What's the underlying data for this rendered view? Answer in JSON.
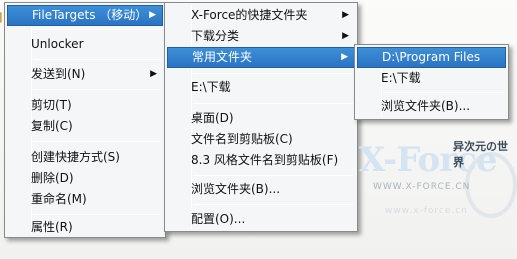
{
  "menu1": {
    "items": [
      {
        "label": "FileTargets （移动）",
        "submenu": true,
        "highlighted": true
      },
      {
        "label": "Unlocker",
        "icon": "unlocker-icon"
      },
      {
        "label": "发送到(N)",
        "submenu": true
      },
      {
        "label": "剪切(T)"
      },
      {
        "label": "复制(C)"
      },
      {
        "label": "创建快捷方式(S)"
      },
      {
        "label": "删除(D)"
      },
      {
        "label": "重命名(M)"
      },
      {
        "label": "属性(R)"
      }
    ]
  },
  "menu2": {
    "items": [
      {
        "label": "X-Force的快捷文件夹",
        "submenu": true
      },
      {
        "label": "下载分类",
        "submenu": true
      },
      {
        "label": "常用文件夹",
        "submenu": true,
        "highlighted": true
      },
      {
        "label": "E:\\下载"
      },
      {
        "label": "桌面(D)"
      },
      {
        "label": "文件名到剪贴板(C)"
      },
      {
        "label": "8.3 风格文件名到剪贴板(F)"
      },
      {
        "label": "浏览文件夹(B)..."
      },
      {
        "label": "配置(O)..."
      }
    ]
  },
  "menu3": {
    "items": [
      {
        "label": "D:\\Program Files",
        "highlighted": true
      },
      {
        "label": "E:\\下载"
      },
      {
        "label": "浏览文件夹(B)..."
      }
    ]
  },
  "watermark": {
    "logo": "X-Force",
    "tagline": "异次元の世界",
    "url": "WWW.X-FORCE.CN"
  },
  "colors": {
    "highlight": "#2b74c4",
    "menu_bg": "#f5f6f7",
    "border": "#8a8a8a"
  }
}
